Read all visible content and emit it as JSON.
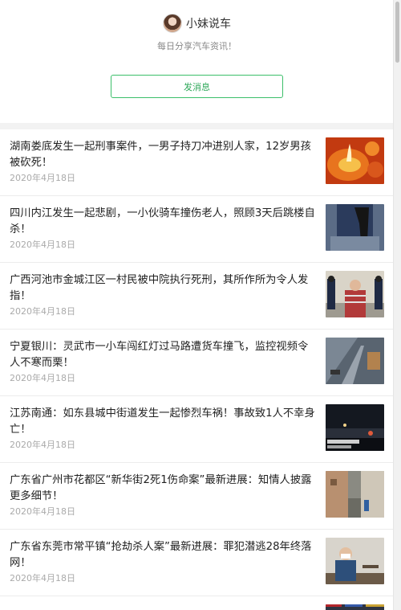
{
  "profile": {
    "name": "小妹说车",
    "description": "每日分享汽车资讯！",
    "button_label": "发消息"
  },
  "articles": [
    {
      "title": "湖南娄底发生一起刑事案件，一男子持刀冲进别人家，12岁男孩被砍死！",
      "date": "2020年4月18日",
      "thumb": "candle"
    },
    {
      "title": "四川内江发生一起悲剧，一小伙骑车撞伤老人，照顾3天后跳楼自杀！",
      "date": "2020年4月18日",
      "thumb": "chair"
    },
    {
      "title": "广西河池市金城江区一村民被中院执行死刑，其所作所为令人发指！",
      "date": "2020年4月18日",
      "thumb": "court"
    },
    {
      "title": "宁夏银川：灵武市一小车闯红灯过马路遭货车撞飞，监控视频令人不寒而栗！",
      "date": "2020年4月18日",
      "thumb": "road"
    },
    {
      "title": "江苏南通：如东县城中街道发生一起惨烈车祸！事故致1人不幸身亡！",
      "date": "2020年4月18日",
      "thumb": "night"
    },
    {
      "title": "广东省广州市花都区“新华街2死1伤命案”最新进展：知情人披露更多细节！",
      "date": "2020年4月18日",
      "thumb": "street"
    },
    {
      "title": "广东省东莞市常平镇“抢劫杀人案”最新进展：罪犯潜逃28年终落网！",
      "date": "2020年4月18日",
      "thumb": "man"
    }
  ]
}
